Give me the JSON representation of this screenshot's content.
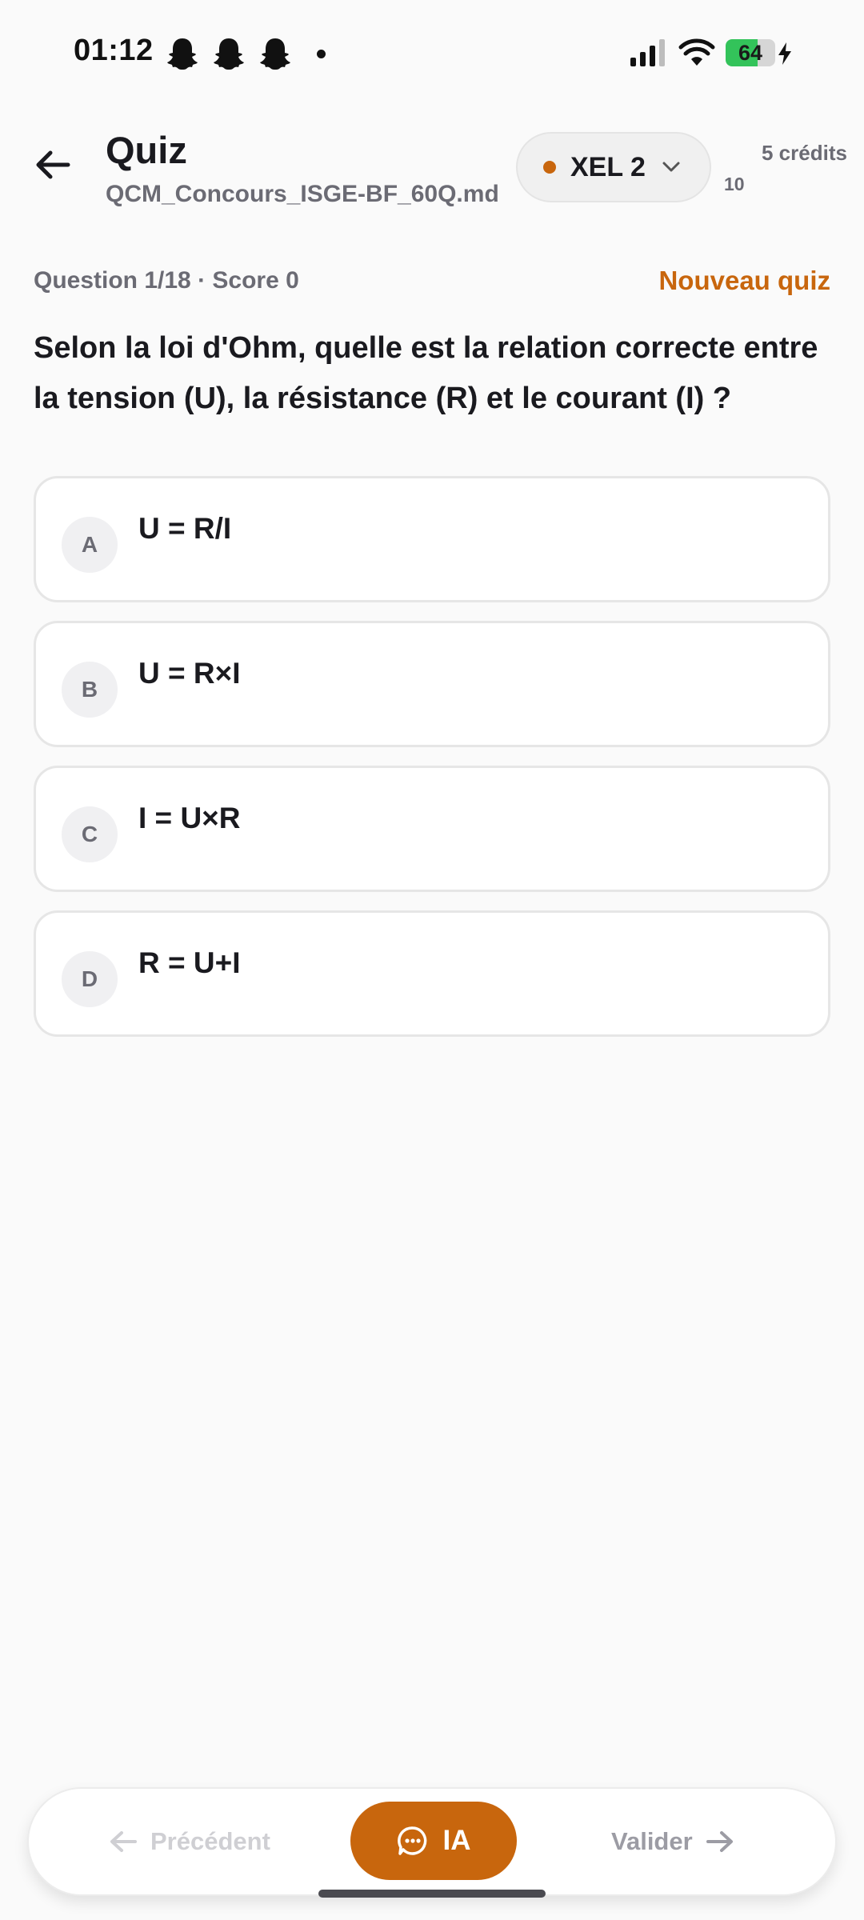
{
  "status_bar": {
    "time": "01:12",
    "battery_percent": "64",
    "battery_level": 0.64,
    "icons": [
      "snapchat-ghost-icon",
      "snapchat-ghost-icon",
      "snapchat-ghost-icon",
      "notification-dot-icon",
      "signal-icon",
      "wifi-icon",
      "battery-icon",
      "charging-bolt-icon"
    ]
  },
  "header": {
    "title": "Quiz",
    "subtitle": "QCM_Concours_ISGE-BF_60Q.md",
    "model": "XEL 2",
    "model_status_color": "#c8660d",
    "credits_label": "5 crédits",
    "credits_count": "10"
  },
  "progress": {
    "text": "Question 1/18 · Score 0",
    "new_quiz": "Nouveau quiz"
  },
  "question": {
    "text": "Selon la loi d'Ohm, quelle est la relation correcte entre la tension (U), la résistance (R) et le courant (I) ?",
    "options": [
      {
        "letter": "A",
        "text": "U = R/I"
      },
      {
        "letter": "B",
        "text": "U = R×I"
      },
      {
        "letter": "C",
        "text": "I = U×R"
      },
      {
        "letter": "D",
        "text": "R = U+I"
      }
    ]
  },
  "bottom_bar": {
    "previous": "Précédent",
    "ia": "IA",
    "validate": "Valider"
  },
  "colors": {
    "accent": "#c8660d",
    "background": "#fafafa",
    "muted_text": "#6b6b74"
  }
}
